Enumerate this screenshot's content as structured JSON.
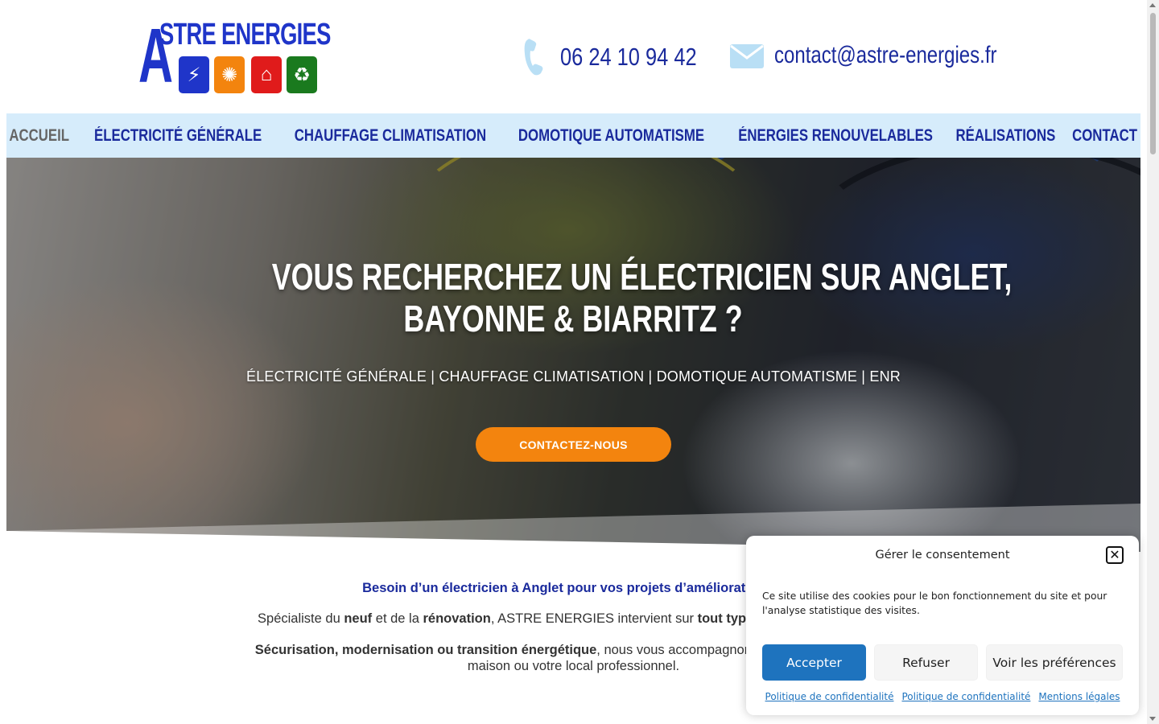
{
  "brand": {
    "logo_text": "STRE ENERGIES",
    "logo_letter": "A",
    "logo_tiles": [
      {
        "icon": "lightning-icon",
        "glyph": "⚡",
        "color": "#1f35c9"
      },
      {
        "icon": "sun-gear-icon",
        "glyph": "✺",
        "color": "#f3840e"
      },
      {
        "icon": "house-icon",
        "glyph": "⌂",
        "color": "#e01b1b"
      },
      {
        "icon": "recycle-icon",
        "glyph": "♻",
        "color": "#1a7a1e"
      }
    ]
  },
  "header": {
    "phone": "06 24 10 94 42",
    "email": "contact@astre-energies.fr"
  },
  "nav": {
    "items": [
      {
        "label": "ACCUEIL",
        "active": true
      },
      {
        "label": "ÉLECTRICITÉ GÉNÉRALE",
        "active": false
      },
      {
        "label": "CHAUFFAGE CLIMATISATION",
        "active": false
      },
      {
        "label": "DOMOTIQUE AUTOMATISME",
        "active": false
      },
      {
        "label": "ÉNERGIES RENOUVELABLES",
        "active": false
      },
      {
        "label": "RÉALISATIONS",
        "active": false
      },
      {
        "label": "CONTACT",
        "active": false
      }
    ]
  },
  "hero": {
    "title_line1": "VOUS RECHERCHEZ UN ÉLECTRICIEN SUR ANGLET,",
    "title_line2": "BAYONNE & BIARRITZ ?",
    "subtitle": "ÉLECTRICITÉ GÉNÉRALE | CHAUFFAGE CLIMATISATION | DOMOTIQUE AUTOMATISME | ENR",
    "cta": "CONTACTEZ-NOUS"
  },
  "intro": {
    "heading": "Besoin d’un électricien à Anglet pour vos projets d’amélioration de",
    "p1": {
      "a": "Spécialiste du ",
      "b": "neuf",
      "c": " et de la ",
      "d": "rénovation",
      "e": ", ASTRE ENERGIES intervient sur ",
      "f": "tout type d’installations électri"
    },
    "p2": {
      "a": "Sécurisation, modernisation ou transition énergétique",
      "b": ", nous vous accompagnons à chaque étape. Profit",
      "c": "maison ou votre local professionnel."
    }
  },
  "cookie": {
    "title": "Gérer le consentement",
    "text": "Ce site utilise des cookies pour le bon fonctionnement du site et pour l'analyse statistique des visites.",
    "accept": "Accepter",
    "refuse": "Refuser",
    "prefs": "Voir les préférences",
    "links": [
      "Politique de confidentialité",
      "Politique de confidentialité",
      "Mentions légales"
    ]
  },
  "colors": {
    "brand_blue": "#1a2a9c",
    "nav_bg": "#d6ecfb",
    "cta_orange": "#f3840e",
    "accept_blue": "#1e73be"
  }
}
